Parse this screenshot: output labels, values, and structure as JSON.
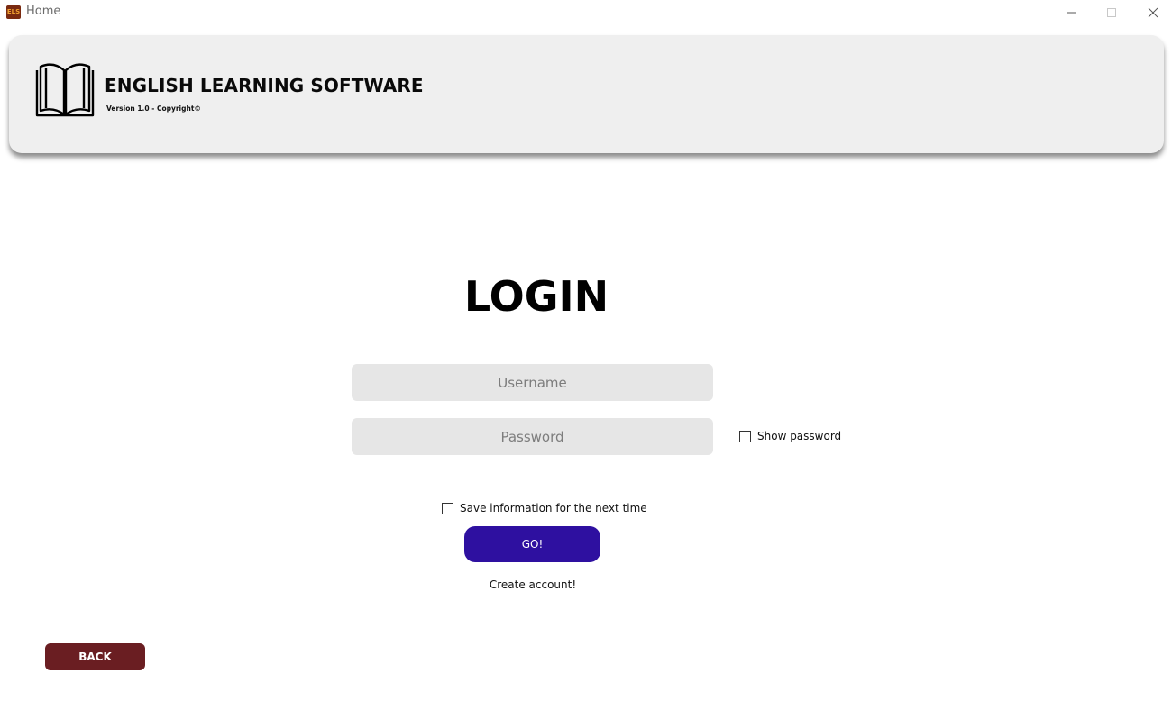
{
  "window": {
    "title": "Home",
    "icon_text": "ELS",
    "controls": [
      "minimize-icon",
      "maximize-icon",
      "close-icon"
    ]
  },
  "header": {
    "logo_icon": "open-book-icon",
    "title": "ENGLISH LEARNING SOFTWARE",
    "version": "Version 1.0 - Copyright©"
  },
  "login": {
    "title": "LOGIN",
    "username_placeholder": "Username",
    "password_placeholder": "Password",
    "show_password_label": "Show password",
    "save_info_label": "Save information for the next time",
    "go_label": "GO!",
    "create_account_label": "Create account!"
  },
  "footer": {
    "back_label": "BACK"
  },
  "colors": {
    "go_button": "#2e10a0",
    "back_button": "#6a1e22",
    "banner_bg": "#efefef",
    "input_bg": "#e6e6e6"
  }
}
